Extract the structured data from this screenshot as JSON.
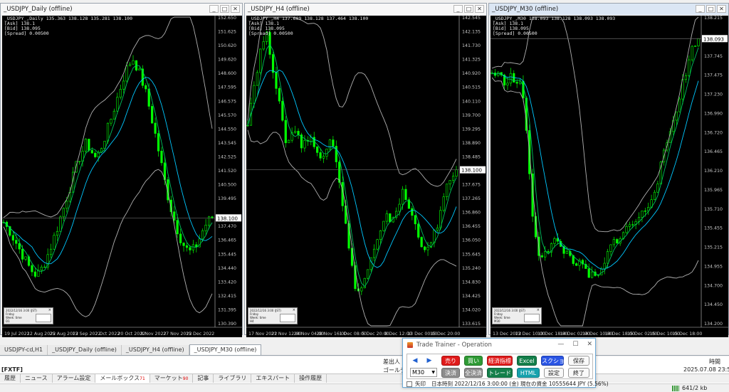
{
  "colors": {
    "candle": "#00ff00",
    "ma_fast": "#00c060",
    "ma_slow": "#00c8ff",
    "band": "#b0b0b0",
    "axis": "#c8c8c8",
    "hline": "#6a6a6a"
  },
  "charts": [
    {
      "id": "daily",
      "title": "_USDJPY_Daily (offline)",
      "ohlc": "_USDJPY_,Daily  135.363 138.128 135.281 138.100",
      "info": [
        "[Ask]  138.1",
        "[Bid]  138.095",
        "[Spread] 0.00500"
      ],
      "prices": [
        "152.650",
        "151.625",
        "150.620",
        "149.620",
        "148.600",
        "147.595",
        "146.575",
        "145.570",
        "144.550",
        "143.545",
        "142.525",
        "141.520",
        "140.500",
        "139.495",
        "138.490",
        "137.470",
        "136.465",
        "135.445",
        "134.440",
        "133.420",
        "132.415",
        "131.395",
        "130.390"
      ],
      "price_tag": "138.100",
      "dates": [
        "19 Jul 2022",
        "12 Aug 2022",
        "25 Aug 2022",
        "13 Sep 2022",
        "2 Oct 2022",
        "20 Oct 2022",
        "8 Nov 2022",
        "27 Nov 2022",
        "15 Dec 2022"
      ],
      "mini": [
        "2022/12/16 3:00 (JST)",
        "Friday",
        "Week:  time",
        "D1"
      ],
      "price_min": 130.2,
      "price_max": 152.8,
      "last": 138.1,
      "path": [
        137.8,
        137.4,
        137.1,
        136.6,
        136.2,
        135.7,
        135.3,
        134.8,
        134.4,
        134.1,
        133.9,
        134.2,
        134.6,
        135.2,
        135.8,
        136.5,
        137.2,
        138,
        138.7,
        139.5,
        140.3,
        141.1,
        141.9,
        142.6,
        143.1,
        143.6,
        143.2,
        142.8,
        142.4,
        143,
        143.6,
        144.3,
        145,
        145.8,
        146.6,
        147.4,
        148.2,
        148.9,
        149.4,
        149.8,
        149.3,
        148.7,
        148,
        147.2,
        146.2,
        145.1,
        144,
        142.8,
        141.6,
        140.4,
        139.3,
        138.4,
        137.6,
        136.9,
        136.3,
        135.9,
        135.6,
        135.7,
        136,
        136.5,
        137.1,
        137.6,
        137.9,
        138.1
      ]
    },
    {
      "id": "h4",
      "title": "_USDJPY_H4 (offline)",
      "ohlc": "_USDJPY_,H4  137.609 138.128 137.464 138.100",
      "info": [
        "[Ask]  138.1",
        "[Bid]  138.095",
        "[Spread] 0.00500"
      ],
      "prices": [
        "142.545",
        "142.135",
        "141.730",
        "141.325",
        "140.920",
        "140.515",
        "140.110",
        "139.700",
        "139.295",
        "138.890",
        "138.485",
        "138.100",
        "137.675",
        "137.265",
        "136.860",
        "136.455",
        "136.050",
        "135.645",
        "135.240",
        "134.830",
        "134.425",
        "134.020",
        "133.615"
      ],
      "price_tag": "138.100",
      "dates": [
        "17 Nov 2022",
        "21 Nov 12:00",
        "24 Nov 04:00",
        "28 Nov 16:00",
        "1 Dec 08:00",
        "5 Dec 20:00",
        "8 Dec 12:00",
        "13 Dec 00:00",
        "15 Dec 20:00"
      ],
      "mini": [
        "2022/12/16 3:00 (JST)",
        "Friday",
        "Week:  time",
        "H4"
      ],
      "price_min": 133.4,
      "price_max": 142.7,
      "last": 138.1,
      "path": [
        139.6,
        140.2,
        140.8,
        141.4,
        141.9,
        142.2,
        141.8,
        141.2,
        140.6,
        139.9,
        139.2,
        138.9,
        139.1,
        139.4,
        139.2,
        138.8,
        138.9,
        139.2,
        139,
        138.6,
        138.4,
        138.5,
        138.9,
        139.2,
        138.8,
        138.2,
        137.4,
        136.6,
        135.8,
        135.1,
        134.6,
        134.4,
        134.6,
        135,
        135.3,
        135.6,
        135.9,
        136.2,
        136.5,
        136.7,
        136.6,
        136.8,
        137.1,
        137.4,
        137.2,
        136.9,
        136.6,
        136.3,
        136,
        135.8,
        135.6,
        135.9,
        136.2,
        136.6,
        137,
        137.4,
        137.7,
        137.9,
        138.1
      ]
    },
    {
      "id": "m30",
      "title": "_USDJPY_M30 (offline)",
      "ohlc": "_USDJPY_,M30  138.093 138.128 138.093 138.093",
      "info": [
        "[Ask]  138.1",
        "[Bid]  138.095",
        "[Spread] 0.00500"
      ],
      "prices": [
        "138.215",
        "137.995",
        "137.745",
        "137.475",
        "137.230",
        "136.990",
        "136.720",
        "136.465",
        "136.210",
        "135.965",
        "135.710",
        "135.455",
        "135.215",
        "134.955",
        "134.700",
        "134.450",
        "134.200"
      ],
      "price_tag": "138.093",
      "dates": [
        "13 Dec 2022",
        "13 Dec 10:00",
        "13 Dec 18:00",
        "14 Dec 02:00",
        "14 Dec 10:00",
        "14 Dec 18:00",
        "15 Dec 02:00",
        "15 Dec 10:00",
        "15 Dec 18:00"
      ],
      "mini": [
        "2022/12/16 3:00 (JST)",
        "Friday",
        "Week:  time",
        "M30"
      ],
      "price_min": 134,
      "price_max": 138.4,
      "last": 138.093,
      "path": [
        137.6,
        137.6,
        137.55,
        137.5,
        137.5,
        137.55,
        137.5,
        137.45,
        137.4,
        137.1,
        136.3,
        135.5,
        135.2,
        135,
        135.05,
        135.1,
        135.15,
        135.2,
        135.15,
        135.1,
        135.05,
        135,
        134.95,
        134.9,
        134.85,
        134.8,
        134.75,
        134.7,
        134.68,
        134.7,
        134.8,
        134.95,
        135.1,
        135.2,
        135.25,
        135.3,
        135.35,
        135.4,
        135.45,
        135.5,
        135.55,
        135.6,
        135.7,
        135.8,
        135.95,
        136.1,
        136.3,
        136.5,
        136.7,
        136.9,
        137.1,
        137.3,
        137.5,
        137.7,
        137.9,
        138.05,
        138.1
      ]
    }
  ],
  "chart_tabs": [
    "USDJPY-cd,H1",
    "_USDJPY_Daily (offline)",
    "_USDJPY_H4 (offline)",
    "_USDJPY_M30 (offline)"
  ],
  "terminal": {
    "left_label": "[FXTF]",
    "col_origin": "差出人",
    "col_time": "時間",
    "row_sender": "ゴールデンウ",
    "row_time": "2025.07.08 23:58"
  },
  "bottom_tabs": [
    {
      "label": "履歴",
      "badge": ""
    },
    {
      "label": "ニュース",
      "badge": ""
    },
    {
      "label": "アラーム設定",
      "badge": ""
    },
    {
      "label": "メールボックス",
      "badge": "71"
    },
    {
      "label": "マーケット",
      "badge": "90"
    },
    {
      "label": "記事",
      "badge": ""
    },
    {
      "label": "ライブラリ",
      "badge": ""
    },
    {
      "label": "エキスパート",
      "badge": ""
    },
    {
      "label": "操作履歴",
      "badge": ""
    }
  ],
  "status_right": "641/2 kb",
  "trainer": {
    "title": "Trade Trainer - Operation",
    "win_min": "—",
    "win_max": "☐",
    "win_close": "✕",
    "prev_icon": "◀",
    "next_icon": "▶",
    "sell": "売り",
    "buy": "買い",
    "indicators": "経済指標",
    "excel": "Excel",
    "screenshot": "スクショ",
    "save": "保存",
    "timeframe": "M30",
    "settle": "決済",
    "settle_all": "全決済",
    "trade": "トレード",
    "html": "HTML",
    "settings": "設定",
    "end": "終了",
    "status_check_label": "矢印",
    "status_text": "日本時刻 2022/12/16 3:00:00 (金)   現在の資金 10555644 JPY (5.56%)"
  }
}
